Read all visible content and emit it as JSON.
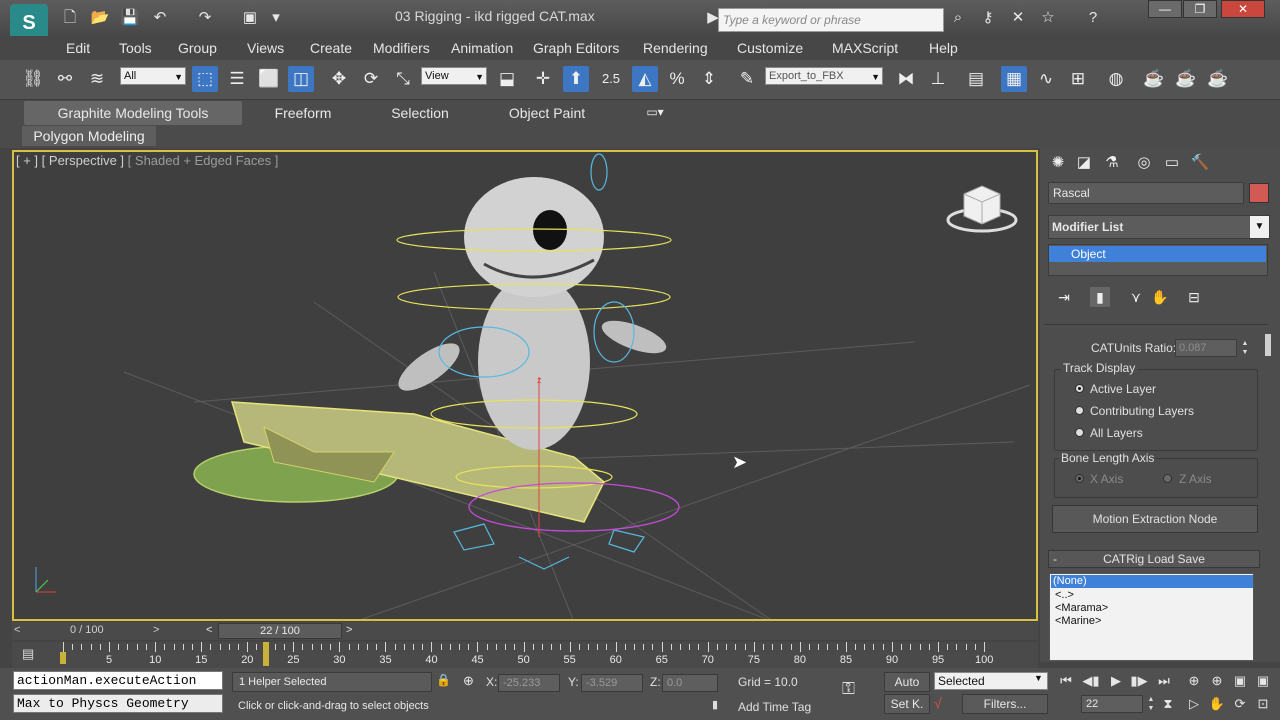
{
  "window": {
    "title": "03 Rigging - ikd rigged CAT.max",
    "search_placeholder": "Type a keyword or phrase",
    "logo": "3ds-max-logo"
  },
  "menu": [
    "Edit",
    "Tools",
    "Group",
    "Views",
    "Create",
    "Modifiers",
    "Animation",
    "Graph Editors",
    "Rendering",
    "Customize",
    "MAXScript",
    "Help"
  ],
  "toolbar": {
    "selection_filter": "All",
    "reference_coord": "View",
    "named_selection": "Export_to_FBX",
    "snap_angle_label": "2.5"
  },
  "ribbon": {
    "tabs": [
      "Graphite Modeling Tools",
      "Freeform",
      "Selection",
      "Object Paint"
    ],
    "active_tab": "Graphite Modeling Tools",
    "subtab": "Polygon Modeling"
  },
  "viewport": {
    "label_prefix": "[ + ]",
    "label_view": "[ Perspective ]",
    "label_shading": "[ Shaded + Edged Faces ]",
    "axis_z": "z"
  },
  "command_panel": {
    "object_name": "Rascal",
    "object_color": "#d15a55",
    "modifier_list_label": "Modifier List",
    "stack_item": "Object",
    "catunits_label": "CATUnits Ratio:",
    "catunits_value": "0.087",
    "track_display_title": "Track Display",
    "track_display_options": [
      "Active Layer",
      "Contributing Layers",
      "All Layers"
    ],
    "track_display_selected": "Active Layer",
    "bone_length_title": "Bone Length Axis",
    "bone_axis_options": [
      "X Axis",
      "Z Axis"
    ],
    "motion_extraction_button": "Motion Extraction Node",
    "load_save_title": "CATRig Load Save",
    "load_save_collapse": "-",
    "rig_list": [
      "(None)",
      "<..>",
      "<Marama>",
      "<Marine>"
    ],
    "rig_list_selected": "(None)"
  },
  "timeline": {
    "range_label": "0 / 100",
    "current_frame_label": "22 / 100",
    "ticks": [
      "0",
      "5",
      "10",
      "15",
      "20",
      "25",
      "30",
      "35",
      "40",
      "45",
      "50",
      "55",
      "60",
      "65",
      "70",
      "75",
      "80",
      "85",
      "90",
      "95",
      "100"
    ],
    "current_frame": 22
  },
  "status": {
    "listener_line1": "actionMan.executeAction",
    "listener_line2": "Max to Physcs Geometry",
    "selection_status": "1 Helper Selected",
    "prompt": "Click or click-and-drag to select objects",
    "x_label": "X:",
    "x_value": "-25.233",
    "y_label": "Y:",
    "y_value": "-3.529",
    "z_label": "Z:",
    "z_value": "0.0",
    "grid": "Grid = 10.0",
    "add_time_tag": "Add Time Tag",
    "auto_key": "Auto",
    "set_key": "Set K.",
    "key_filter": "Selected",
    "filters": "Filters...",
    "frame_field": "22"
  }
}
